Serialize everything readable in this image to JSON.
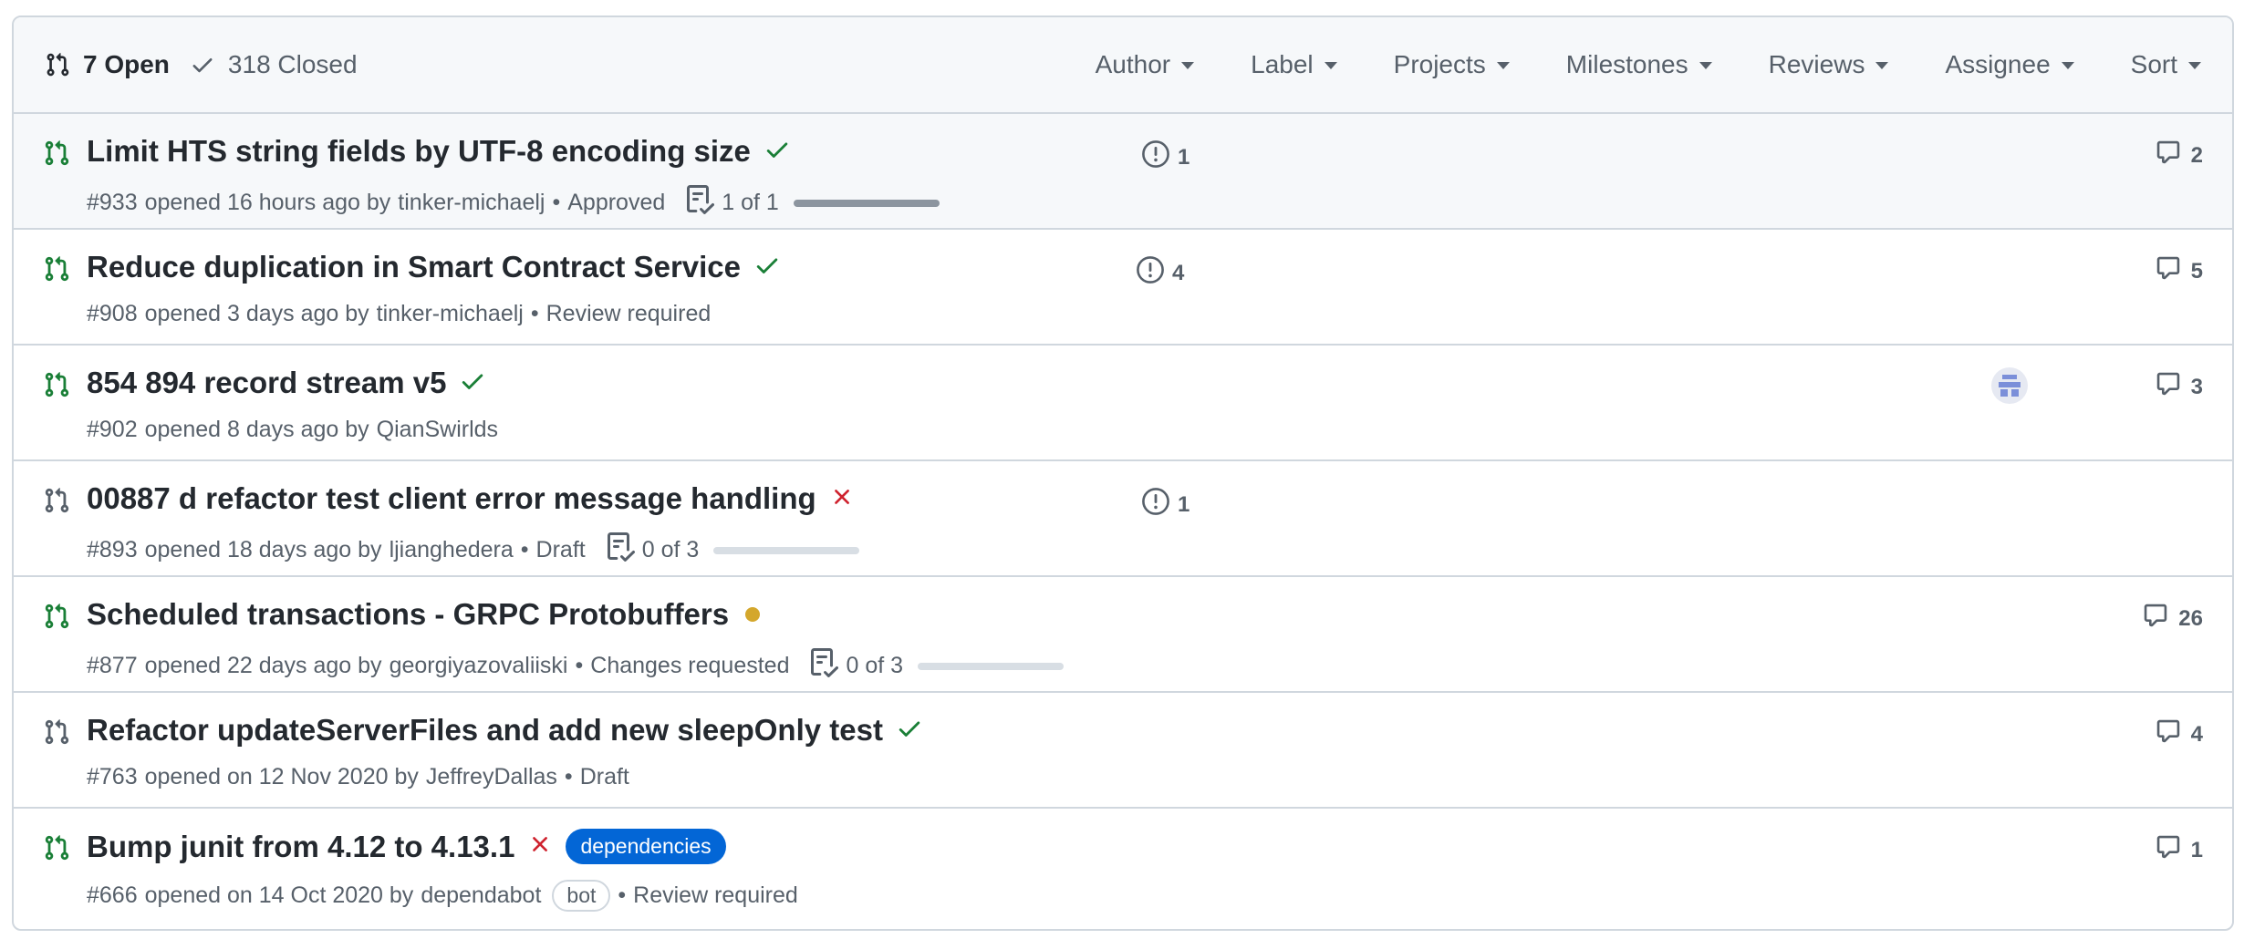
{
  "header": {
    "open_label": "7 Open",
    "closed_label": "318 Closed",
    "filters": [
      "Author",
      "Label",
      "Projects",
      "Milestones",
      "Reviews",
      "Assignee",
      "Sort"
    ]
  },
  "pulls": [
    {
      "title": "Limit HTS string fields by UTF-8 encoding size",
      "status": "success",
      "number": "#933",
      "opened": "opened 16 hours ago by",
      "author": "tinker-michaelj",
      "review": "Approved",
      "tasks": "1 of 1",
      "tasks_fraction": 1.0,
      "linked_issues": "1",
      "comments": "2",
      "draft": false
    },
    {
      "title": "Reduce duplication in Smart Contract Service",
      "status": "success",
      "number": "#908",
      "opened": "opened 3 days ago by",
      "author": "tinker-michaelj",
      "review": "Review required",
      "linked_issues": "4",
      "comments": "5",
      "draft": false
    },
    {
      "title": "854 894 record stream v5",
      "status": "success",
      "number": "#902",
      "opened": "opened 8 days ago by",
      "author": "QianSwirlds",
      "comments": "3",
      "assignee_avatar": true,
      "draft": false
    },
    {
      "title": "00887 d refactor test client error message handling",
      "status": "failure",
      "number": "#893",
      "opened": "opened 18 days ago by",
      "author": "ljianghedera",
      "review": "Draft",
      "tasks": "0 of 3",
      "tasks_fraction": 0.0,
      "linked_issues": "1",
      "draft": true
    },
    {
      "title": "Scheduled transactions - GRPC Protobuffers",
      "status": "pending",
      "number": "#877",
      "opened": "opened 22 days ago by",
      "author": "georgiyazovaliiski",
      "review": "Changes requested",
      "tasks": "0 of 3",
      "tasks_fraction": 0.0,
      "comments": "26",
      "draft": false
    },
    {
      "title": "Refactor updateServerFiles and add new sleepOnly test",
      "status": "success",
      "number": "#763",
      "opened": "opened on 12 Nov 2020 by",
      "author": "JeffreyDallas",
      "review": "Draft",
      "comments": "4",
      "draft": true
    },
    {
      "title": "Bump junit from 4.12 to 4.13.1",
      "status": "failure",
      "label": "dependencies",
      "number": "#666",
      "opened": "opened on 14 Oct 2020 by",
      "author": "dependabot",
      "bot": "bot",
      "review": "Review required",
      "comments": "1",
      "draft": false
    }
  ],
  "colors": {
    "open_green": "#1a7f37",
    "draft_gray": "#57606a",
    "check_green": "#1a7f37",
    "fail_red": "#cf222e",
    "pending_yellow": "#d4a72c",
    "label_blue": "#0366d6"
  }
}
